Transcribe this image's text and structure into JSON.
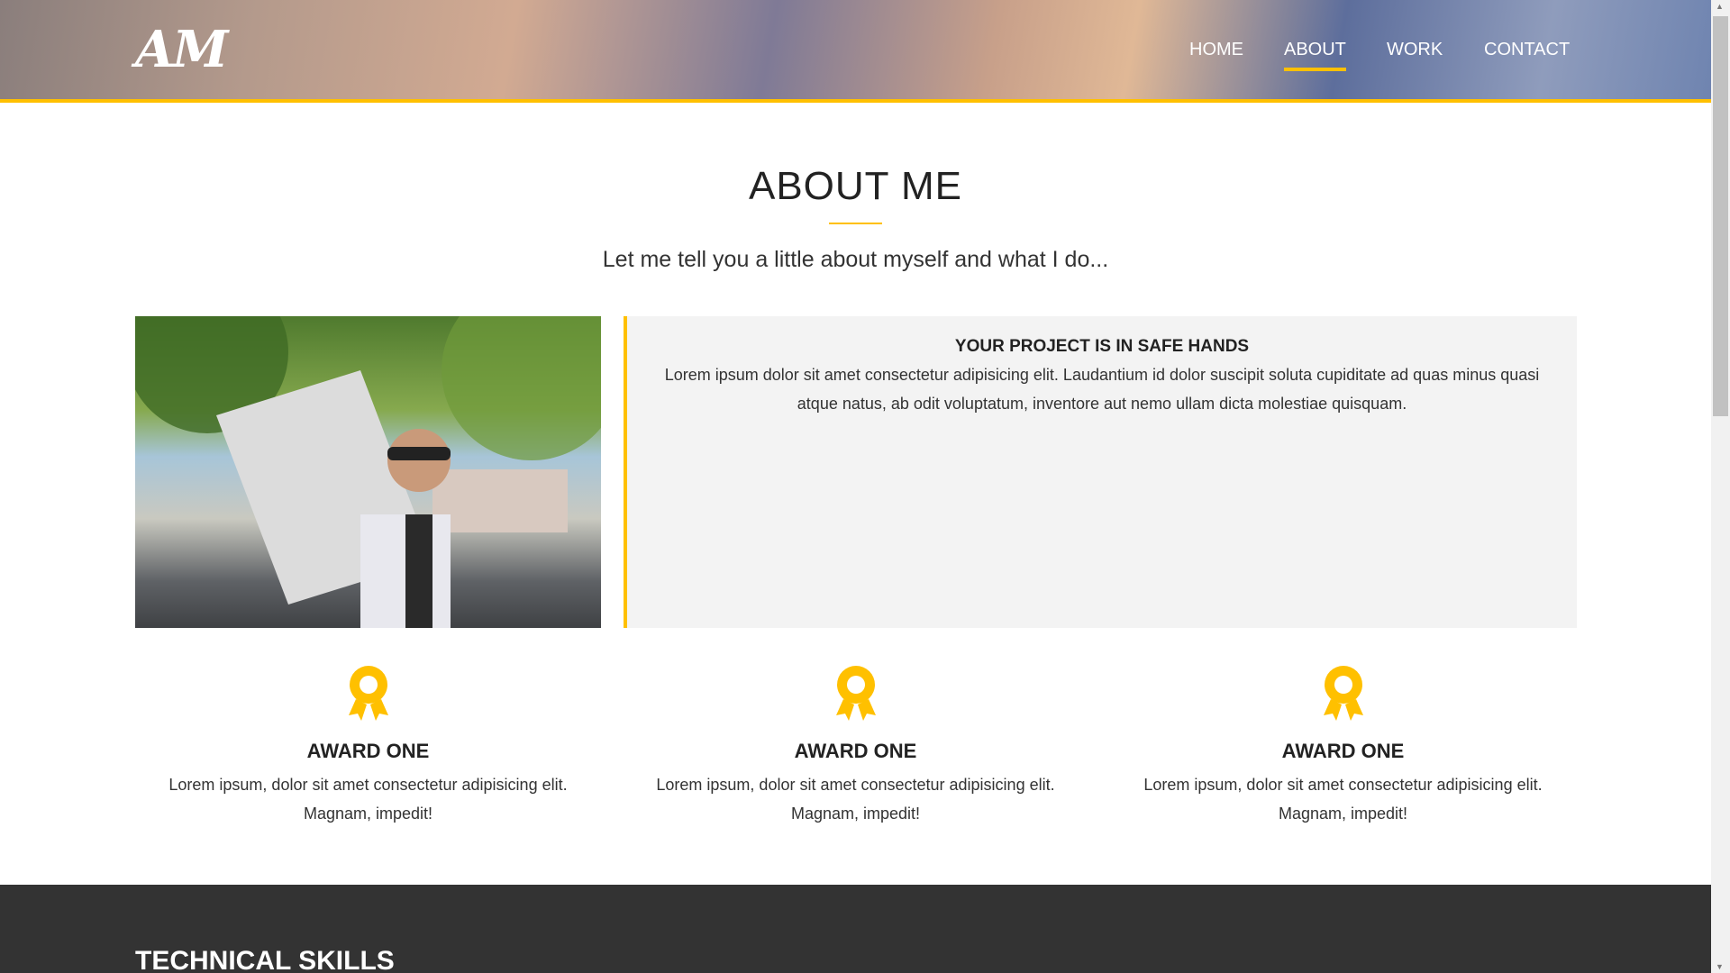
{
  "header": {
    "logo": "AM",
    "nav": [
      {
        "label": "HOME"
      },
      {
        "label": "ABOUT",
        "active": true
      },
      {
        "label": "WORK"
      },
      {
        "label": "CONTACT"
      }
    ]
  },
  "about": {
    "title": "ABOUT ME",
    "subtitle": "Let me tell you a little about myself and what I do...",
    "card": {
      "title": "YOUR PROJECT IS IN SAFE HANDS",
      "text": "Lorem ipsum dolor sit amet consectetur adipisicing elit. Laudantium id dolor suscipit soluta cupiditate ad quas minus quasi atque natus, ab odit voluptatum, inventore aut nemo ullam dicta molestiae quisquam."
    }
  },
  "awards": [
    {
      "title": "AWARD ONE",
      "text": "Lorem ipsum, dolor sit amet consectetur adipisicing elit. Magnam, impedit!"
    },
    {
      "title": "AWARD ONE",
      "text": "Lorem ipsum, dolor sit amet consectetur adipisicing elit. Magnam, impedit!"
    },
    {
      "title": "AWARD ONE",
      "text": "Lorem ipsum, dolor sit amet consectetur adipisicing elit. Magnam, impedit!"
    }
  ],
  "skills": {
    "title": "TECHNICAL SKILLS"
  },
  "colors": {
    "accent": "#ffc000",
    "dark": "#333333"
  }
}
